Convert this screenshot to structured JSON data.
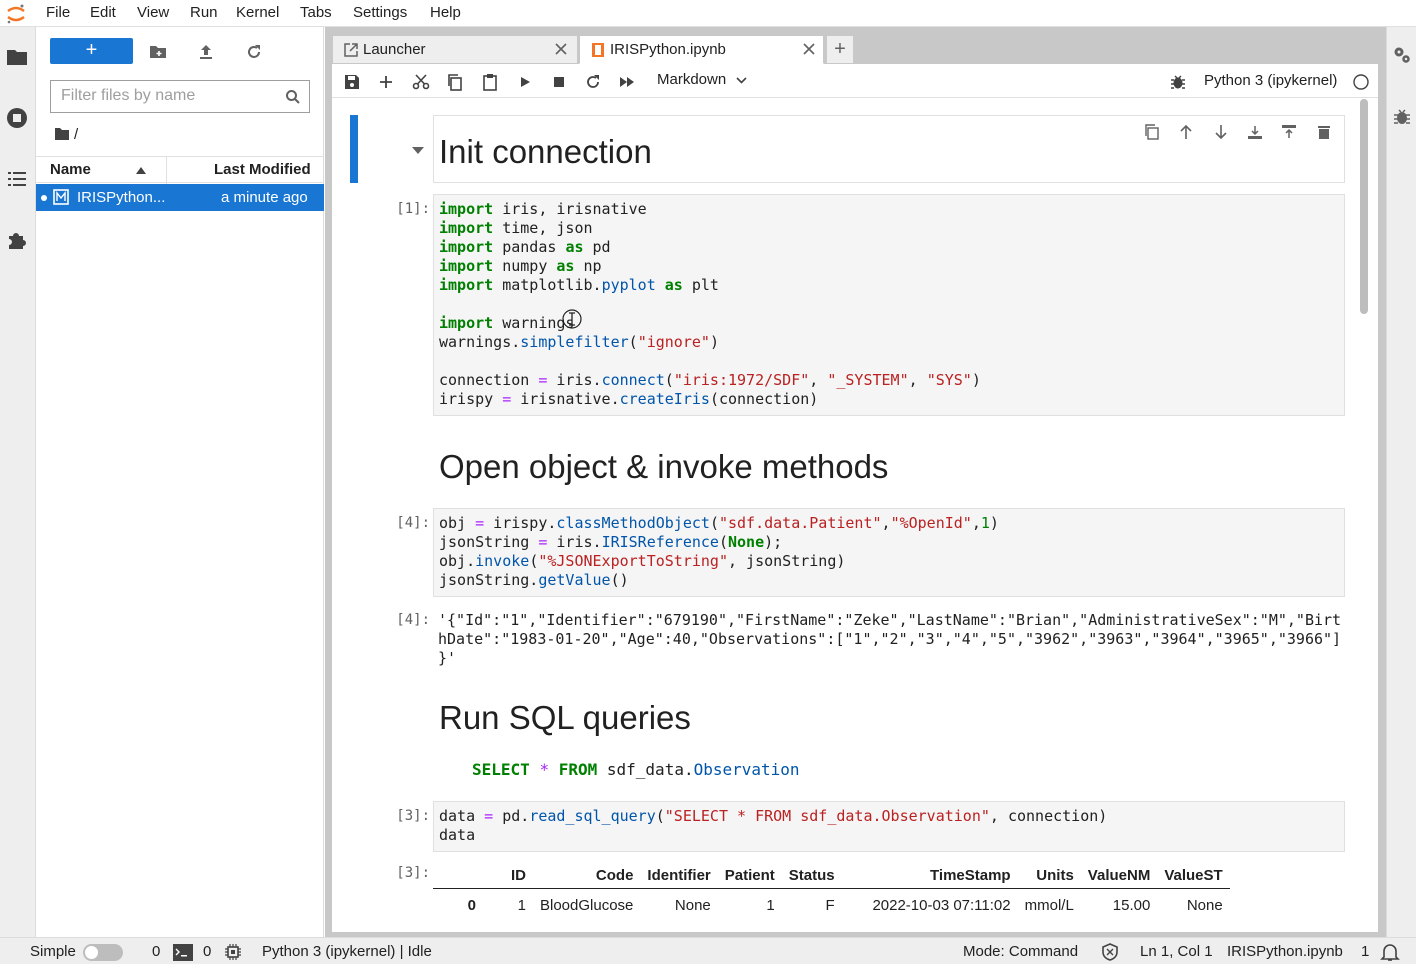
{
  "menubar": {
    "items": [
      "File",
      "Edit",
      "View",
      "Run",
      "Kernel",
      "Tabs",
      "Settings",
      "Help"
    ]
  },
  "filebrowser": {
    "new_button": "+",
    "filter_placeholder": "Filter files by name",
    "breadcrumb": "/",
    "columns": {
      "name": "Name",
      "modified": "Last Modified"
    },
    "files": [
      {
        "name": "IRISPython...",
        "modified": "a minute ago"
      }
    ]
  },
  "tabs": [
    {
      "label": "Launcher",
      "icon": "launcher-icon"
    },
    {
      "label": "IRISPython.ipynb",
      "icon": "notebook-icon"
    }
  ],
  "toolbar": {
    "cell_type": "Markdown",
    "kernel_name": "Python 3 (ipykernel)"
  },
  "notebook": {
    "heading1": "Init connection",
    "cell1_prompt": "[1]:",
    "heading2": "Open object & invoke methods",
    "cell2_prompt": "[4]:",
    "out2_prompt": "[4]:",
    "out2_lines": [
      "'{\"Id\":\"1\",\"Identifier\":\"679190\",\"FirstName\":\"Zeke\",\"LastName\":\"Brian\",\"AdministrativeSex\":\"M\",\"Birt",
      "hDate\":\"1983-01-20\",\"Age\":40,\"Observations\":[\"1\",\"2\",\"3\",\"4\",\"5\",\"3962\",\"3963\",\"3964\",\"3965\",\"3966\"]",
      "}'"
    ],
    "heading3": "Run SQL queries",
    "sql_keywords": [
      "SELECT",
      "*",
      "FROM"
    ],
    "sql_table": "sdf_data.",
    "sql_table_attr": "Observation",
    "cell3_prompt": "[3]:",
    "out3_prompt": "[3]:",
    "table": {
      "columns": [
        "",
        "ID",
        "Code",
        "Identifier",
        "Patient",
        "Status",
        "TimeStamp",
        "Units",
        "ValueNM",
        "ValueST"
      ],
      "rows": [
        [
          "0",
          "1",
          "BloodGlucose",
          "None",
          "1",
          "F",
          "2022-10-03 07:11:02",
          "mmol/L",
          "15.00",
          "None"
        ]
      ]
    }
  },
  "statusbar": {
    "mode_label": "Simple",
    "terminals": "0",
    "kernels": "0",
    "kernel_status": "Python 3 (ipykernel) | Idle",
    "mode": "Mode: Command",
    "position": "Ln 1, Col 1",
    "filename": "IRISPython.ipynb",
    "notifications": "1"
  },
  "colors": {
    "accent": "#1976d2",
    "keyword": "#008000",
    "string": "#ba2121",
    "function": "#0055aa",
    "operator": "#aa22ff"
  }
}
